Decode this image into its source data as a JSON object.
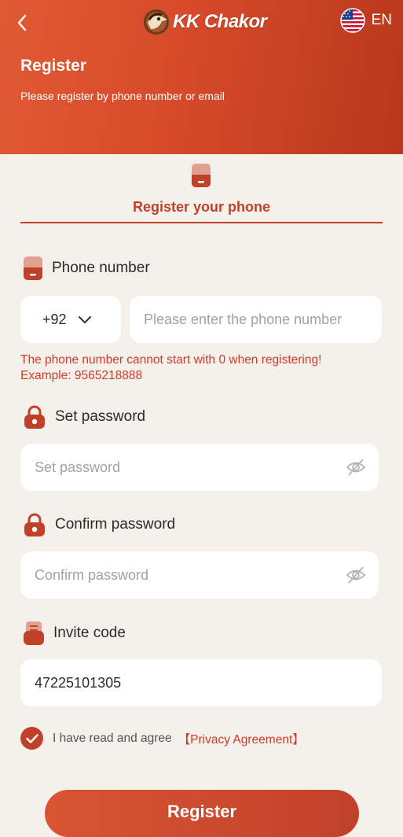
{
  "header": {
    "logo_text": "KK Chakor",
    "language": "EN",
    "title": "Register",
    "subtitle": "Please register by phone number or email"
  },
  "tab": {
    "label": "Register your phone"
  },
  "phone": {
    "label": "Phone number",
    "country_code": "+92",
    "placeholder": "Please enter the phone number",
    "error_line1": "The phone number cannot start with 0 when registering!",
    "error_line2": "Example: 9565218888"
  },
  "password": {
    "label": "Set password",
    "placeholder": "Set password"
  },
  "confirm_password": {
    "label": "Confirm password",
    "placeholder": "Confirm password"
  },
  "invite": {
    "label": "Invite code",
    "value": "47225101305"
  },
  "agreement": {
    "text": "I have read and agree",
    "link": "【Privacy Agreement】"
  },
  "register_button": {
    "label": "Register"
  },
  "colors": {
    "accent": "#c0412a",
    "error": "#d23a2a",
    "background": "#f4f0ea"
  }
}
